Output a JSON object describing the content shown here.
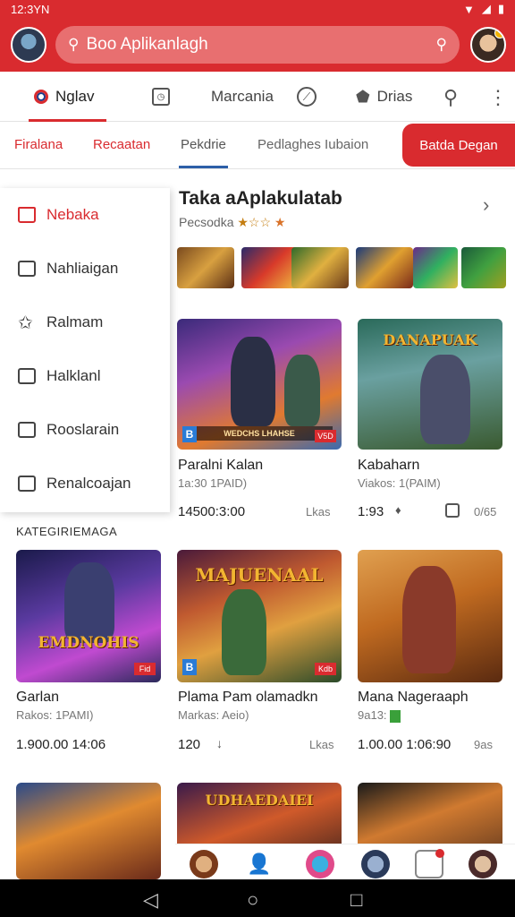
{
  "status": {
    "time": "12:3YN",
    "battery_icon": "battery-icon"
  },
  "header": {
    "search_placeholder": "Boo Aplikanlagh",
    "search_icon": "search-icon",
    "brand_color": "#d92b2f"
  },
  "tabs_primary": [
    {
      "label": "Nglav",
      "icon": "target-icon",
      "active": true
    },
    {
      "label": "",
      "icon": "clock-square-icon"
    },
    {
      "label": "Marcania",
      "icon": ""
    },
    {
      "label": "",
      "icon": "compass-icon"
    },
    {
      "label": "Drias",
      "icon": "label-icon"
    }
  ],
  "tabs_secondary": [
    {
      "label": "Firalana"
    },
    {
      "label": "Recaatan"
    },
    {
      "label": "Pekdrie"
    },
    {
      "label": "Pedlaghes Iubaion"
    }
  ],
  "promo_button": "Batda Degan",
  "drawer": {
    "items": [
      {
        "label": "Nebaka",
        "icon": "home-icon",
        "active": true
      },
      {
        "label": "Nahliaigan",
        "icon": "square-icon"
      },
      {
        "label": "Ralmam",
        "icon": "star-outline-icon"
      },
      {
        "label": "Halklanl",
        "icon": "edit-square-icon"
      },
      {
        "label": "Rooslarain",
        "icon": "square-dot-icon"
      },
      {
        "label": "Renalcoajan",
        "icon": "square-dot-icon"
      }
    ]
  },
  "section": {
    "title": "Taka aAplakulatab",
    "subtitle": "Pecsodka",
    "stars": "★☆☆",
    "rating_level": 1
  },
  "cards_row1": [
    {
      "title": "Paralni Kalan",
      "meta": "1a:30 1PAID)",
      "stat": "14500:3:00",
      "stat_right": "Lkas",
      "banner": "WEDCHS LHAHSE",
      "badge": "V5D"
    },
    {
      "title": "Kabaharn",
      "meta": "Viakos: 1(PAIM)",
      "stat": "1:93",
      "stat_right": "0/65",
      "bigtxt": "DANAPUAK"
    }
  ],
  "category_label": "KATEGIRIEMAGA",
  "cards_row2": [
    {
      "title": "Garlan",
      "meta": "Rakos: 1PAMI)",
      "stat": "1.900.00 14:06",
      "stat_right": "",
      "bigtxt": "EMDNOHIS",
      "badge": "Fid"
    },
    {
      "title": "Plama Pam olamadkn",
      "meta": "Markas: Aeio)",
      "stat": "120",
      "stat_right": "Lkas",
      "bigtxt": "MAJUENAAL",
      "badge": "Kdb"
    },
    {
      "title": "Mana Nageraaph",
      "meta": "9a13:",
      "stat": "1.00.00 1:06:90",
      "stat_right": "9as"
    }
  ],
  "cards_row3": [
    {
      "bigtxt": ""
    },
    {
      "bigtxt": "UDHAEDAIEI"
    },
    {
      "bigtxt": ""
    }
  ],
  "navbar": {
    "back": "◁",
    "home": "○",
    "recent": "□"
  }
}
